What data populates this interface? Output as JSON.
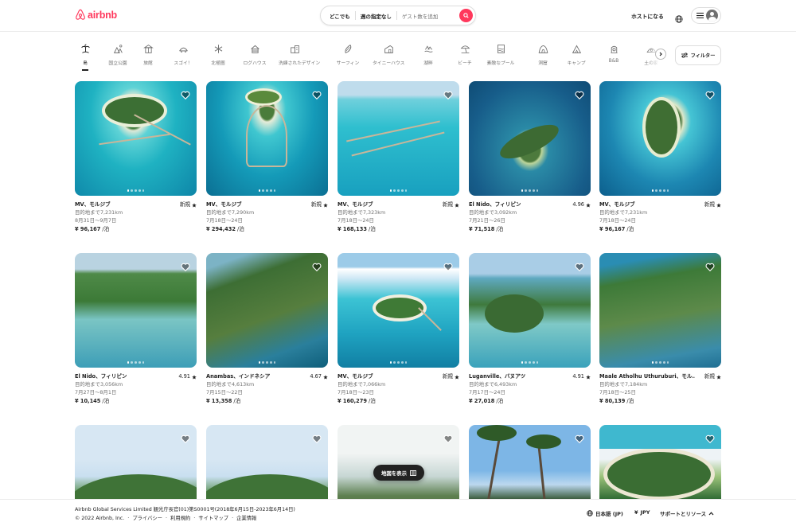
{
  "header": {
    "logo_text": "airbnb",
    "search": {
      "where": "どこでも",
      "when": "週の指定なし",
      "guests": "ゲスト数を追加"
    },
    "host_label": "ホストになる"
  },
  "categories": [
    {
      "label": "島",
      "icon": "island-icon",
      "active": true
    },
    {
      "label": "国立公園",
      "icon": "national-park-icon"
    },
    {
      "label": "旅館",
      "icon": "ryokan-icon"
    },
    {
      "label": "スゴイ！",
      "icon": "omg-icon"
    },
    {
      "label": "北極圏",
      "icon": "snowflake-icon"
    },
    {
      "label": "ログハウス",
      "icon": "cabin-icon"
    },
    {
      "label": "洗練されたデザイン",
      "icon": "design-icon"
    },
    {
      "label": "サーフィン",
      "icon": "surf-icon"
    },
    {
      "label": "タイニーハウス",
      "icon": "tiny-house-icon"
    },
    {
      "label": "湖畔",
      "icon": "lakefront-icon"
    },
    {
      "label": "ビーチ",
      "icon": "beach-icon"
    },
    {
      "label": "素敵なプール",
      "icon": "pool-icon"
    },
    {
      "label": "洞窟",
      "icon": "cave-icon"
    },
    {
      "label": "キャンプ",
      "icon": "camping-icon"
    },
    {
      "label": "B&B",
      "icon": "bnb-icon"
    },
    {
      "label": "土の家",
      "icon": "earth-home-icon"
    }
  ],
  "filter_label": "フィルター",
  "listings": [
    {
      "location": "MV、モルジブ",
      "rating": "新規",
      "distance": "目的地まで7,231km",
      "dates": "8月31日～9月7日",
      "price": "¥ 96,167",
      "unit": " /泊",
      "photo": "ph-water1"
    },
    {
      "location": "MV、モルジブ",
      "rating": "新規",
      "distance": "目的地まで7,290km",
      "dates": "7月18日～24日",
      "price": "¥ 294,432",
      "unit": " /泊",
      "photo": "ph-water2"
    },
    {
      "location": "MV、モルジブ",
      "rating": "新規",
      "distance": "目的地まで7,323km",
      "dates": "7月18日～24日",
      "price": "¥ 168,133",
      "unit": " /泊",
      "photo": "ph-water3"
    },
    {
      "location": "El Nido、フィリピン",
      "rating": "4.96",
      "distance": "目的地まで3,092km",
      "dates": "7月21日～26日",
      "price": "¥ 71,518",
      "unit": " /泊",
      "photo": "ph-water4"
    },
    {
      "location": "MV、モルジブ",
      "rating": "新規",
      "distance": "目的地まで7,231km",
      "dates": "7月18日～24日",
      "price": "¥ 96,167",
      "unit": " /泊",
      "photo": "ph-water5"
    },
    {
      "location": "El Nido、フィリピン",
      "rating": "4.91",
      "distance": "目的地まで3,056km",
      "dates": "7月27日～8月1日",
      "price": "¥ 10,145",
      "unit": " /泊",
      "photo": "ph-isl1"
    },
    {
      "location": "Anambas、インドネシア",
      "rating": "4.67",
      "distance": "目的地まで4,613km",
      "dates": "7月15日～22日",
      "price": "¥ 13,358",
      "unit": " /泊",
      "photo": "ph-isl2"
    },
    {
      "location": "MV、モルジブ",
      "rating": "新規",
      "distance": "目的地まで7,066km",
      "dates": "7月18日～23日",
      "price": "¥ 160,279",
      "unit": " /泊",
      "photo": "ph-isl3"
    },
    {
      "location": "Luganville、バヌアツ",
      "rating": "4.91",
      "distance": "目的地まで6,493km",
      "dates": "7月17日～24日",
      "price": "¥ 27,018",
      "unit": " /泊",
      "photo": "ph-isl4"
    },
    {
      "location": "Maale Atholhu Uthuruburi、モル...",
      "rating": "新規",
      "distance": "目的地まで7,184km",
      "dates": "7月18日～25日",
      "price": "¥ 80,139",
      "unit": " /泊",
      "photo": "ph-isl5"
    }
  ],
  "row3_photos": [
    "ph-sky1",
    "ph-sky1",
    "ph-sky2",
    "ph-sky4",
    "ph-sky3"
  ],
  "map_button_label": "地図を表示",
  "footer": {
    "line1": "Airbnb Global Services Limited 観光庁長官(01)第S0001号(2018年6月15日-2023年6月14日)",
    "copyright": "© 2022 Airbnb, Inc.",
    "links": [
      "プライバシー",
      "利用規約",
      "サイトマップ",
      "企業情報"
    ],
    "language": "日本語 (JP)",
    "currency_symbol": "¥",
    "currency": "JPY",
    "support": "サポートとリソース"
  },
  "colors": {
    "brand": "#FF385C",
    "text": "#222222",
    "muted": "#717171"
  }
}
